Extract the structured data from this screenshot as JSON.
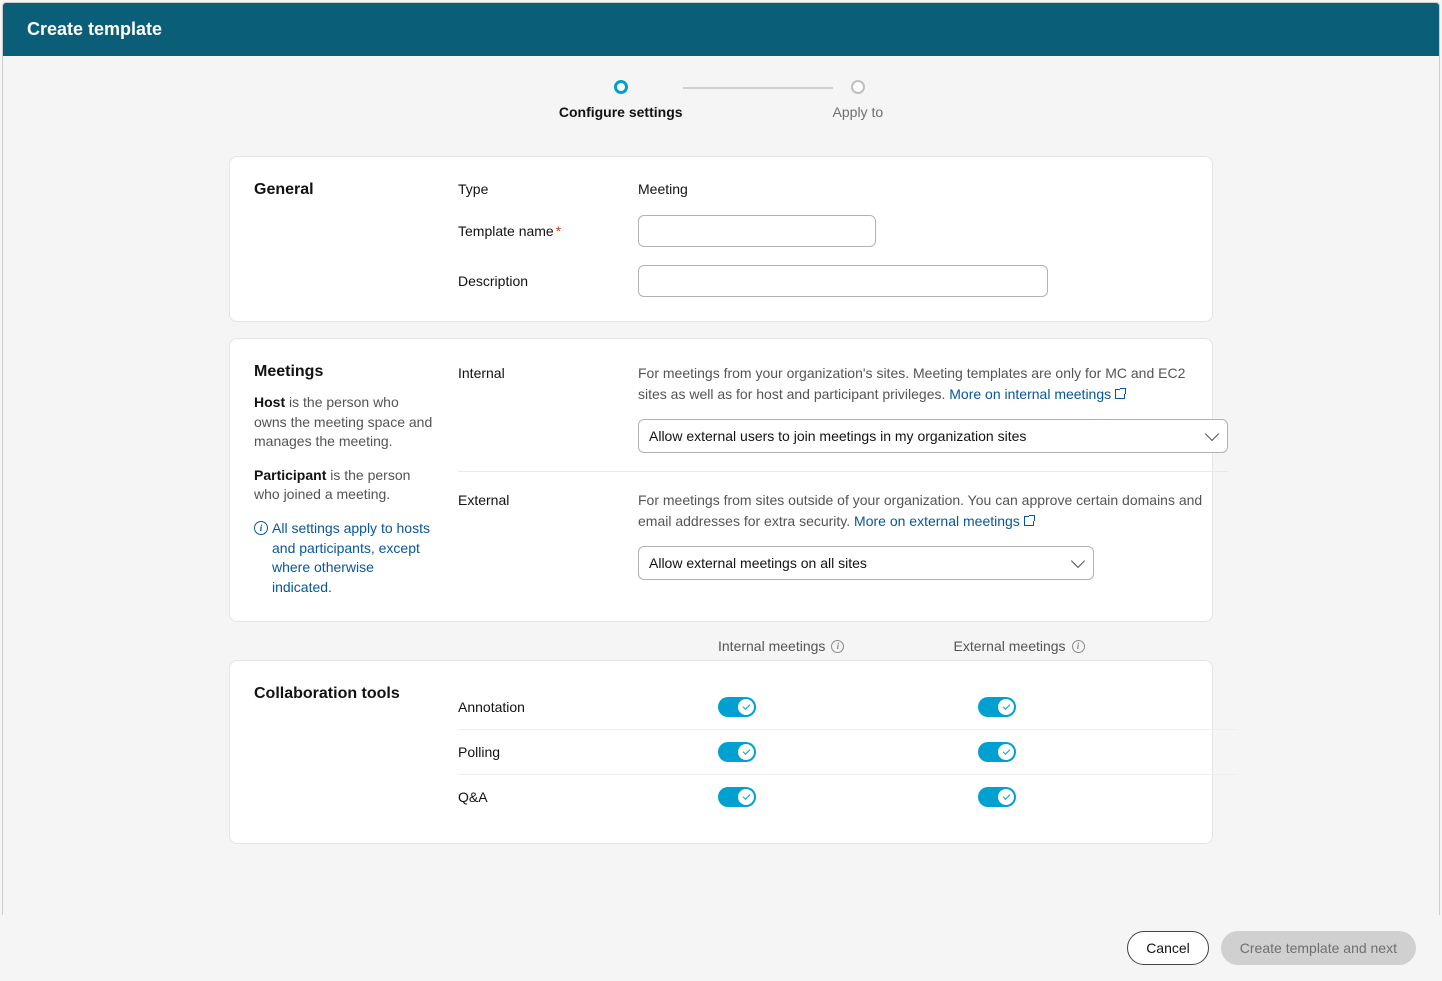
{
  "header": {
    "title": "Create template"
  },
  "stepper": {
    "step1": "Configure settings",
    "step2": "Apply to"
  },
  "general": {
    "title": "General",
    "type_label": "Type",
    "type_value": "Meeting",
    "template_name_label": "Template name",
    "description_label": "Description"
  },
  "meetings": {
    "title": "Meetings",
    "host_strong": "Host",
    "host_text": " is the person who owns the meeting space and manages the meeting.",
    "participant_strong": "Participant",
    "participant_text": " is the person who joined a meeting.",
    "info_note": "All settings apply to hosts and participants, except where otherwise indicated.",
    "internal_label": "Internal",
    "internal_desc": "For meetings from your organization's sites. Meeting templates are only for MC and EC2 sites as well as for host and participant privileges. ",
    "internal_link": "More on internal meetings",
    "internal_select": "Allow external users to join meetings in my organization sites",
    "external_label": "External",
    "external_desc": "For meetings from sites outside of your organization. You can approve certain domains and email addresses for extra security. ",
    "external_link": "More on external meetings",
    "external_select": "Allow external meetings on all sites"
  },
  "collab": {
    "title": "Collaboration tools",
    "col_internal": "Internal meetings",
    "col_external": "External meetings",
    "rows": {
      "annotation": "Annotation",
      "polling": "Polling",
      "qa": "Q&A"
    }
  },
  "footer": {
    "cancel": "Cancel",
    "next": "Create template and next"
  }
}
